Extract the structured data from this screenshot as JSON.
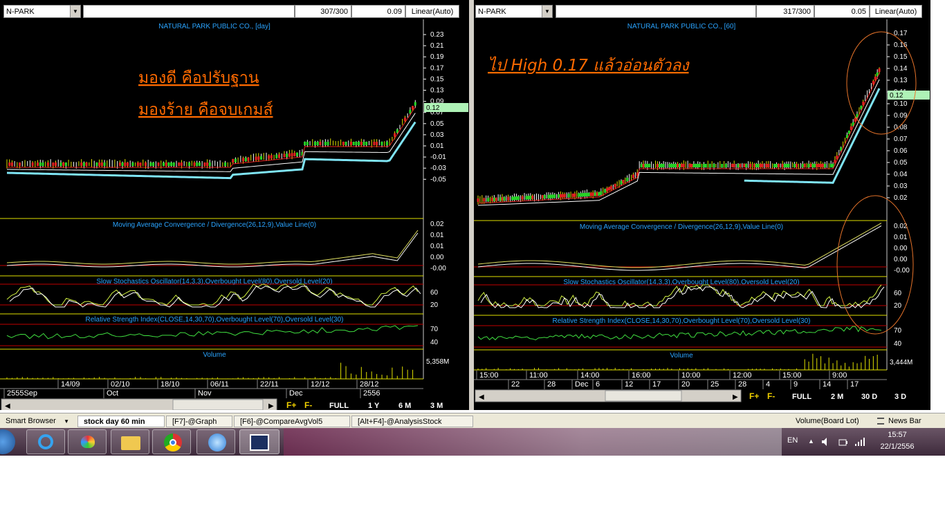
{
  "left": {
    "symbol": "N-PARK",
    "count": "307/300",
    "value": "0.09",
    "scale": "Linear(Auto)",
    "title": "NATURAL PARK PUBLIC CO., [day]",
    "annotation1": "มองดี คือปรับฐาน",
    "annotation2": "มองร้าย คือจบเกมส์",
    "price_labels": [
      "0.23",
      "0.21",
      "0.19",
      "0.17",
      "0.15",
      "0.13",
      "0.09",
      "0.07",
      "0.05",
      "0.03",
      "0.01",
      "-0.01",
      "-0.03",
      "-0.05"
    ],
    "current_price": "0.12",
    "macd_title": "Moving Average Convergence / Divergence(26,12,9),Value Line(0)",
    "macd_labels": [
      "0.02",
      "0.01",
      "0.01",
      "0.00",
      "-0.00"
    ],
    "stoch_title": "Slow Stochastics Oscillator(14,3,3),Overbought Level(80),Oversold Level(20)",
    "stoch_labels": [
      "60",
      "20"
    ],
    "rsi_title": "Relative Strength Index(CLOSE,14,30,70),Overbought Level(70),Oversold Level(30)",
    "rsi_labels": [
      "70",
      "40"
    ],
    "volume_title": "Volume",
    "volume_label": "5,358M",
    "date_row1": [
      "14/09",
      "02/10",
      "18/10",
      "06/11",
      "22/11",
      "12/12",
      "28/12"
    ],
    "date_row2": [
      "2555Sep",
      "Oct",
      "Nov",
      "Dec",
      "2556"
    ],
    "buttons": [
      "F+",
      "F-",
      "FULL",
      "1 Y",
      "6 M",
      "3 M"
    ]
  },
  "right": {
    "symbol": "N-PARK",
    "count": "317/300",
    "value": "0.05",
    "scale": "Linear(Auto)",
    "title": "NATURAL PARK PUBLIC CO., [60]",
    "annotation": "ไป High 0.17 แล้วอ่อนตัวลง",
    "price_labels": [
      "0.17",
      "0.16",
      "0.15",
      "0.14",
      "0.13",
      "0.11",
      "0.10",
      "0.09",
      "0.08",
      "0.07",
      "0.06",
      "0.05",
      "0.04",
      "0.03",
      "0.02"
    ],
    "current_price": "0.12",
    "macd_title": "Moving Average Convergence / Divergence(26,12,9),Value Line(0)",
    "macd_labels": [
      "0.02",
      "0.01",
      "0.00",
      "0.00",
      "-0.00"
    ],
    "stoch_title": "Slow Stochastics Oscillator(14,3,3),Overbought Level(80),Oversold Level(20)",
    "stoch_labels": [
      "60",
      "20"
    ],
    "rsi_title": "Relative Strength Index(CLOSE,14,30,70),Overbought Level(70),Oversold Level(30)",
    "rsi_labels": [
      "70",
      "40"
    ],
    "volume_title": "Volume",
    "volume_label": "3,444M",
    "date_row1": [
      "15:00",
      "11:00",
      "14:00",
      "16:00",
      "10:00",
      "12:00",
      "15:00",
      "9:00"
    ],
    "date_row2": [
      "22",
      "28",
      "Dec",
      "6",
      "12",
      "17",
      "20",
      "25",
      "28",
      "4",
      "9",
      "14",
      "17"
    ],
    "buttons": [
      "F+",
      "F-",
      "FULL",
      "2 M",
      "30 D",
      "3 D"
    ]
  },
  "tabs": {
    "browser": "Smart Browser",
    "items": [
      "stock day 60 min",
      "[F7]-@Graph",
      "[F6]-@CompareAvgVol5",
      "[Alt+F4]-@AnalysisStock"
    ],
    "volume_board": "Volume(Board Lot)",
    "news": "News Bar"
  },
  "taskbar": {
    "lang": "EN",
    "time": "15:57",
    "date": "22/1/2556"
  },
  "colors": {
    "title_blue": "#2aa4ff",
    "annotation": "#ff6a00",
    "grid_yellow": "#e0e000",
    "band_red": "#c00000",
    "ma_cyan": "#7fe4f4"
  }
}
